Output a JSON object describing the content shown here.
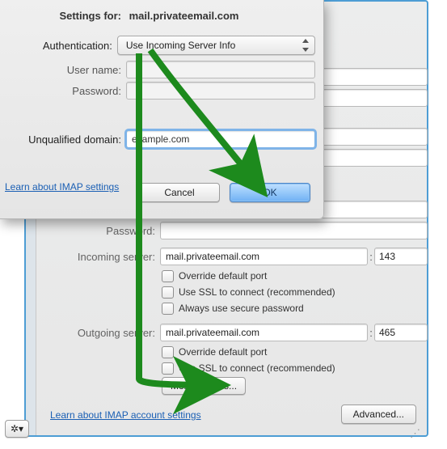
{
  "sheet": {
    "title_prefix": "Settings for:",
    "title_value": "mail.privateemail.com",
    "auth_label": "Authentication:",
    "auth_value": "Use Incoming Server Info",
    "username_label": "User name:",
    "username_value": "",
    "password_label": "Password:",
    "password_value": "",
    "domain_label": "Unqualified domain:",
    "domain_value": "example.com",
    "link": "Learn about IMAP settings",
    "cancel": "Cancel",
    "ok": "OK"
  },
  "bg": {
    "password_label": "Password:",
    "incoming_label": "Incoming server:",
    "incoming_value": "mail.privateemail.com",
    "incoming_port": "143",
    "outgoing_label": "Outgoing server:",
    "outgoing_value": "mail.privateemail.com",
    "outgoing_port": "465",
    "override": "Override default port",
    "ssl": "Use SSL to connect (recommended)",
    "secure_pw": "Always use secure password",
    "more_options": "More Options...",
    "link": "Learn about IMAP account settings",
    "advanced": "Advanced...",
    "separator": ":"
  }
}
